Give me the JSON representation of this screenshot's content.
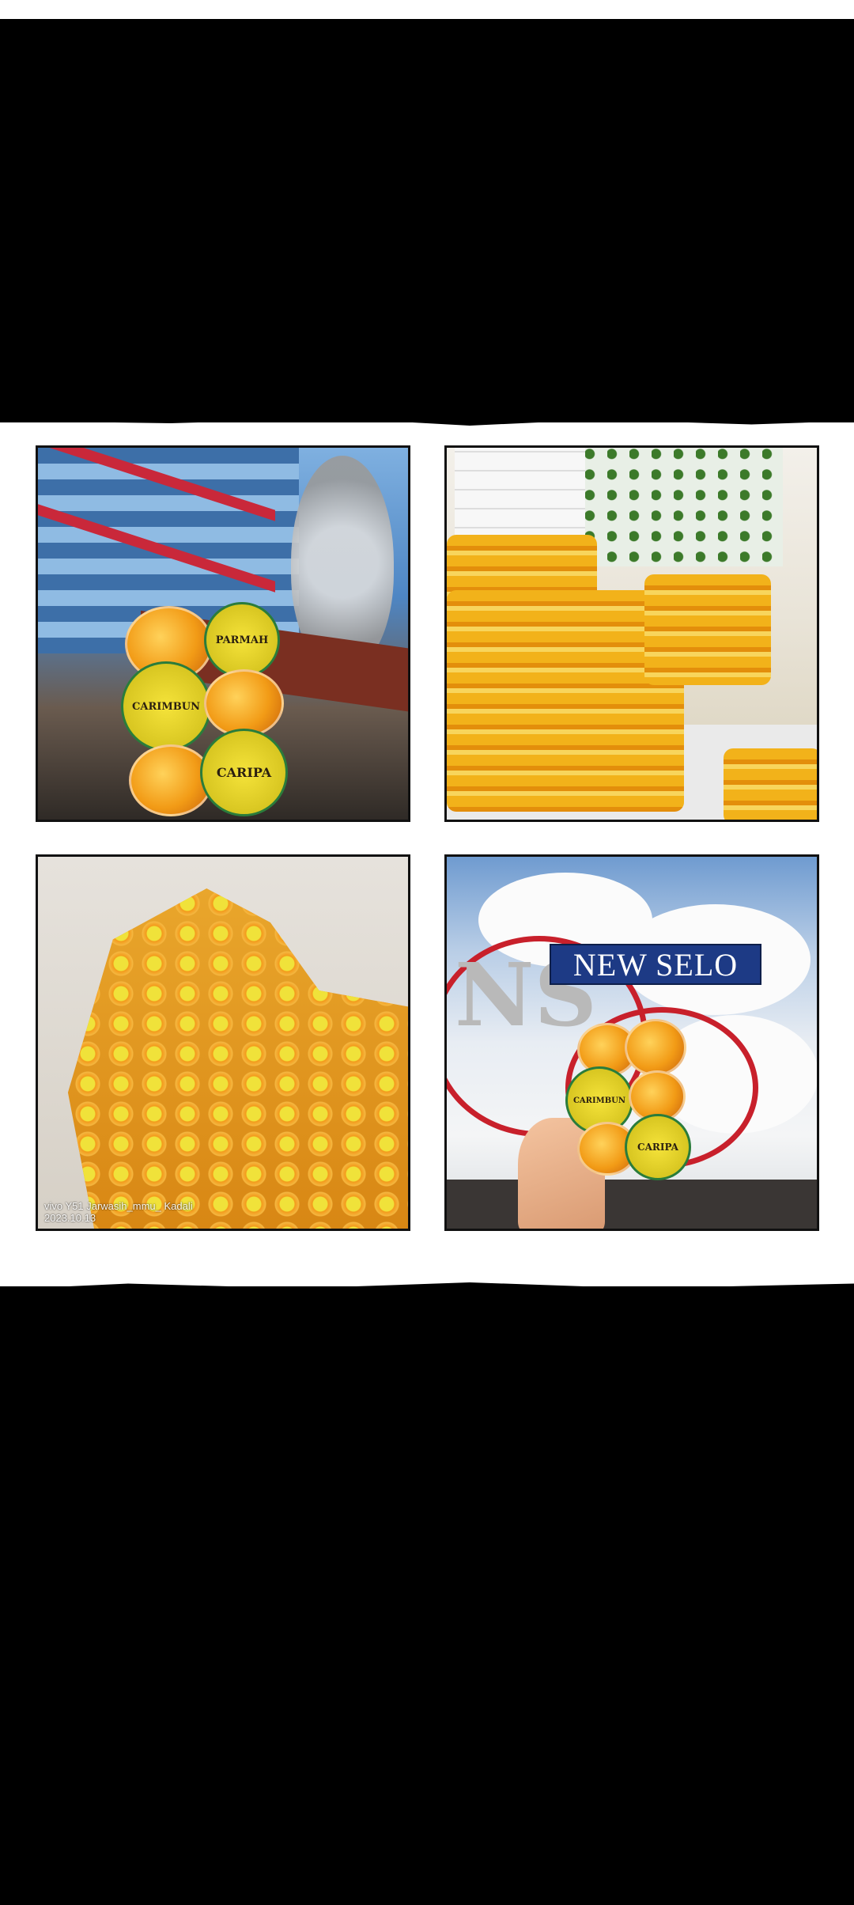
{
  "collage": {
    "photo1": {
      "labels": [
        "PARMAH",
        "CARIMBUN",
        "CARIPA"
      ]
    },
    "photo3": {
      "watermark_line1": "vivo Y51  Jarwasih_mmu_ Kadali",
      "watermark_line2": "2023.10.13"
    },
    "photo4": {
      "monogram": "NS",
      "sign_text": "NEW SELO",
      "labels": [
        "CARIMBUN",
        "CARIPA"
      ]
    }
  },
  "colors": {
    "background": "#000000",
    "band": "#ffffff",
    "jelly_orange": "#f29b16",
    "label_yellow": "#f5e33a",
    "sign_blue": "#1d3a85",
    "heart_red": "#c8202b"
  }
}
